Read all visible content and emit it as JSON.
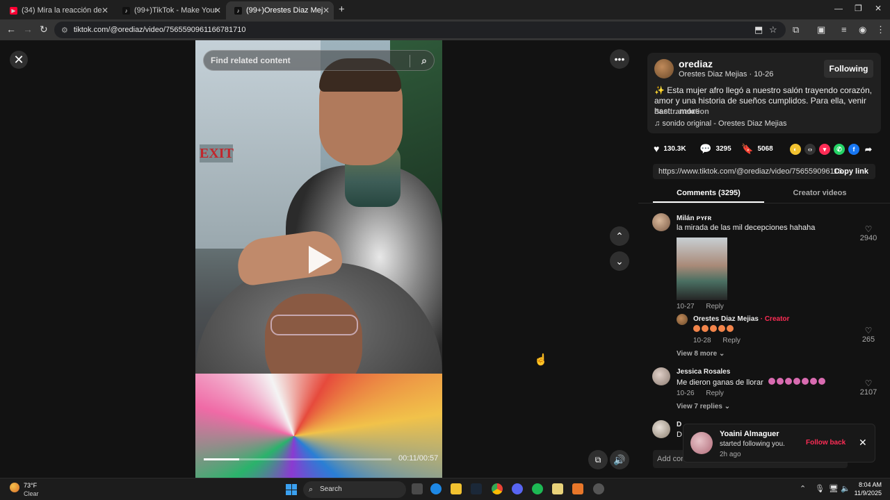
{
  "browser": {
    "tabs": [
      {
        "title": "(34) Mira la reacción de su herm",
        "icon_color": "#ff0033"
      },
      {
        "title": "(99+)TikTok - Make Your Day",
        "icon_color": "#111111"
      },
      {
        "title": "(99+)Orestes Diaz Mejias (@ore",
        "icon_color": "#111111"
      }
    ],
    "url": "tiktok.com/@orediaz/video/7565590961166781710"
  },
  "video": {
    "search_placeholder": "Find related content",
    "exit_sign": "EXIT",
    "timecode": "00:11/00:57",
    "progress": 0.19
  },
  "author": {
    "username": "orediaz",
    "display_line": "Orestes Diaz Mejias · 10-26",
    "follow_label": "Following",
    "description": "✨ Esta mujer afro llegó a nuestro salón trayendo corazón, amor y una historia de sueños cumplidos. Para ella, venir hast...",
    "more_label": "more",
    "see_translation": "See translation",
    "music": "sonido original - Orestes Diaz Mejias"
  },
  "actions": {
    "likes": "130.3K",
    "comments": "3295",
    "saves": "5068"
  },
  "link": {
    "url": "https://www.tiktok.com/@orediaz/video/756559096116...",
    "copy_label": "Copy link"
  },
  "tabs": {
    "comments": "Comments (3295)",
    "creator_videos": "Creator videos"
  },
  "comments": [
    {
      "user": "Milán ᴘʏғʀ",
      "text": "la mirada de las mil decepciones hahaha",
      "date": "10-27",
      "reply": "Reply",
      "likes": "2940",
      "reply_user": "Orestes Diaz Mejias",
      "reply_creator": "· Creator",
      "reply_date": "10-28",
      "reply_reply": "Reply",
      "reply_likes": "265",
      "view_more": "View 8 more ⌄"
    },
    {
      "user": "Jessica Rosales",
      "text": "Me dieron ganas de llorar",
      "date": "10-26",
      "reply": "Reply",
      "likes": "2107",
      "view_more": "View 7 replies ⌄"
    },
    {
      "user": "D",
      "text": "D"
    }
  ],
  "add_comment_placeholder": "Add com",
  "toast": {
    "name": "Yoaini Almaguer",
    "message": "started following you.",
    "time": "2h ago",
    "follow_back": "Follow back"
  },
  "taskbar": {
    "temp": "73°F",
    "condition": "Clear",
    "search": "Search",
    "time": "8:04 AM",
    "date": "11/9/2025"
  }
}
